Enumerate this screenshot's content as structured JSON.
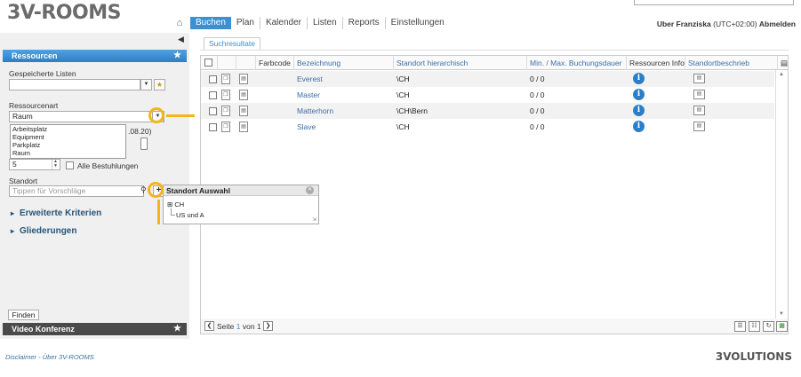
{
  "header": {
    "logo_prefix": "3V",
    "logo_suffix": "-ROOMS",
    "nav": [
      {
        "label": "Buchen",
        "active": true
      },
      {
        "label": "Plan",
        "active": false
      },
      {
        "label": "Kalender",
        "active": false
      },
      {
        "label": "Listen",
        "active": false
      },
      {
        "label": "Reports",
        "active": false
      },
      {
        "label": "Einstellungen",
        "active": false
      }
    ],
    "user_name": "Uber Franziska",
    "timezone": "(UTC+02:00)",
    "logout": "Abmelden"
  },
  "sidebar": {
    "panel_title": "Ressourcen",
    "saved_lists_label": "Gespeicherte Listen",
    "saved_lists_value": "",
    "resource_type_label": "Ressourcenart",
    "resource_type_value": "Raum",
    "resource_type_options": [
      "Arbeitsplatz",
      "Equipment",
      "Parkplatz",
      "Raum"
    ],
    "partial_date": ".08.20)",
    "seats_value": "5",
    "all_seatings_label": "Alle Bestuhlungen",
    "location_label": "Standort",
    "location_placeholder": "Tippen für Vorschläge",
    "advanced_criteria": "Erweiterte Kriterien",
    "groupings": "Gliederungen",
    "find_button": "Finden",
    "video_conf_title": "Video Konferenz"
  },
  "standort_popup": {
    "title": "Standort Auswahl",
    "tree": [
      "CH",
      "US und A"
    ]
  },
  "main": {
    "tab": "Suchresultate",
    "columns": [
      "Farbcode",
      "Bezeichnung",
      "Standort hierarchisch",
      "Min. / Max. Buchungsdauer",
      "Ressourcen Info",
      "Standortbeschrieb"
    ],
    "rows": [
      {
        "name": "Everest",
        "location": "\\CH",
        "duration": "0 / 0"
      },
      {
        "name": "Master",
        "location": "\\CH",
        "duration": "0 / 0"
      },
      {
        "name": "Matterhorn",
        "location": "\\CH\\Bern",
        "duration": "0 / 0"
      },
      {
        "name": "Slave",
        "location": "\\CH",
        "duration": "0 / 0"
      }
    ],
    "pager_prefix": "Seite",
    "pager_current": "1",
    "pager_middle": "von",
    "pager_total": "1"
  },
  "footer": {
    "disclaimer": "Disclaimer",
    "separator": "-",
    "about": "Über 3V-ROOMS",
    "brand": "3VOLUTIONS"
  },
  "colors": {
    "accent": "#3b8fd3",
    "callout": "#f2b51c",
    "panel_dark": "#4a4a4a"
  }
}
